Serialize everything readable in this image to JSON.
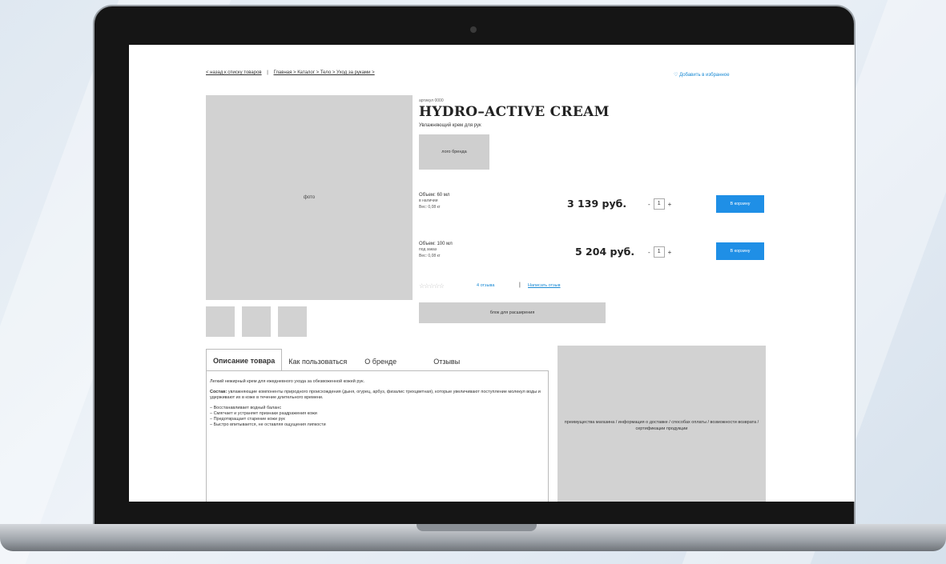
{
  "breadcrumbs": {
    "back": "< назад к списку товаров",
    "divider": "|",
    "path": "Главная > Каталог > Тело > Уход за руками >"
  },
  "favorites_label": "Добавить в избранное",
  "gallery": {
    "main_photo_label": "фото",
    "thumbnail_count": 3
  },
  "product": {
    "article": "артикул 0000",
    "title": "HYDRO–ACTIVE CREAM",
    "subtitle": "Увлажняющий крем для рук",
    "brand_logo_label": "лого бренда"
  },
  "variants": [
    {
      "volume": "Объем: 60 мл",
      "availability": "в наличии",
      "weight": "Вес: 0,08 кг",
      "price": "3 139 руб.",
      "qty": "1",
      "cart_label": "В корзину"
    },
    {
      "volume": "Объем: 100 мл",
      "availability": "под заказ",
      "weight": "Вес: 0,08 кг",
      "price": "5 204 руб.",
      "qty": "1",
      "cart_label": "В корзину"
    }
  ],
  "qty_controls": {
    "minus": "-",
    "plus": "+"
  },
  "rating": {
    "stars": "☆☆☆☆☆",
    "reviews_link": "4 отзыва",
    "separator": "|",
    "write_review": "Написать отзыв"
  },
  "expand_block_label": "блок для расширения",
  "tabs": [
    {
      "label": "Описание товара",
      "active": true
    },
    {
      "label": "Как пользоваться",
      "active": false
    },
    {
      "label": "О бренде",
      "active": false
    },
    {
      "label": "Отзывы",
      "active": false
    }
  ],
  "description": {
    "intro": "Легкий нежирный крем для ежедневного ухода за обезвоженной кожей рук.",
    "composition_label": "Состав:",
    "composition_text": "увлажняющие компоненты природного происхождения (дыня, огурец, арбуз, физалис трехцветная), которые увеличивают поступление молекул воды и удерживают их в коже в течение длительного времени.",
    "bullets": [
      "– Восстанавливает водный баланс",
      "– Смягчает и устраняет признаки раздражения кожи",
      "– Предотвращает старение кожи рук",
      "– Быстро впитывается, не оставляя ощущения липкости"
    ]
  },
  "sidebox_text": "преимущества магазина / информация о доставке / способах оплаты / возможности возврата / сертификации продукции",
  "colors": {
    "accent": "#1f8fe6",
    "placeholder": "#d2d2d2",
    "bezel": "#151515"
  }
}
